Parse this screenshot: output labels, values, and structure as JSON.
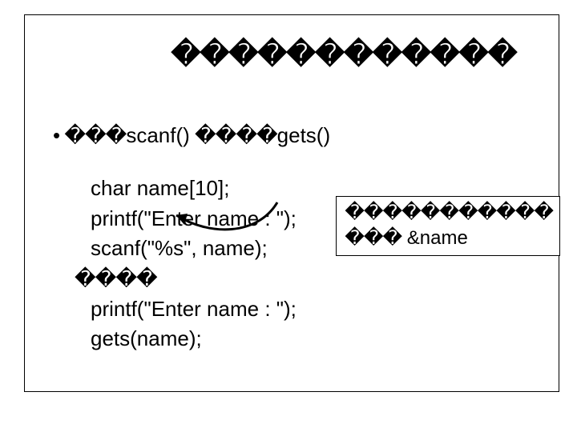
{
  "title": "������������",
  "bullet": {
    "prefix": "• ���",
    "mid1": "scanf()",
    "gap": " ����",
    "mid2": "gets()"
  },
  "code": {
    "l1": "char name[10];",
    "l2": "printf(\"Enter name : \");",
    "l3": "scanf(\"%s\", name);",
    "l4": "����",
    "l5": "printf(\"Enter name : \");",
    "l6": "gets(name);"
  },
  "note": {
    "l1": "�����������",
    "l2": "��� &name"
  }
}
